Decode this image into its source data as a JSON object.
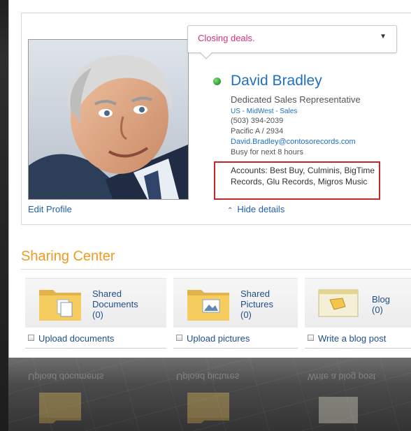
{
  "profile": {
    "status_message": "Closing deals.",
    "name": "David Bradley",
    "job_title": "Dedicated Sales Representative",
    "department": "US - MidWest - Sales",
    "phone": "(503) 394-2039",
    "office": "Pacific A / 2934",
    "email": "David.Bradley@contosorecords.com",
    "availability": "Busy for next 8 hours",
    "accounts": "Accounts: Best Buy, Culminis, BigTime Records, Glu Records, Migros Music",
    "edit_profile_label": "Edit Profile",
    "hide_details_label": "Hide details",
    "presence_color": "#2a9a2a"
  },
  "sharing_center": {
    "title": "Sharing Center",
    "accent_color": "#f09a1e",
    "tiles": [
      {
        "line1": "Shared",
        "line2": "Documents",
        "count": "(0)",
        "icon": "documents-folder-icon"
      },
      {
        "line1": "Shared",
        "line2": "Pictures",
        "count": "(0)",
        "icon": "pictures-folder-icon"
      },
      {
        "line1": "Blog",
        "line2": "",
        "count": "(0)",
        "icon": "blog-icon"
      }
    ],
    "actions": [
      {
        "label": "Upload documents"
      },
      {
        "label": "Upload pictures"
      },
      {
        "label": "Write a blog post"
      }
    ]
  }
}
